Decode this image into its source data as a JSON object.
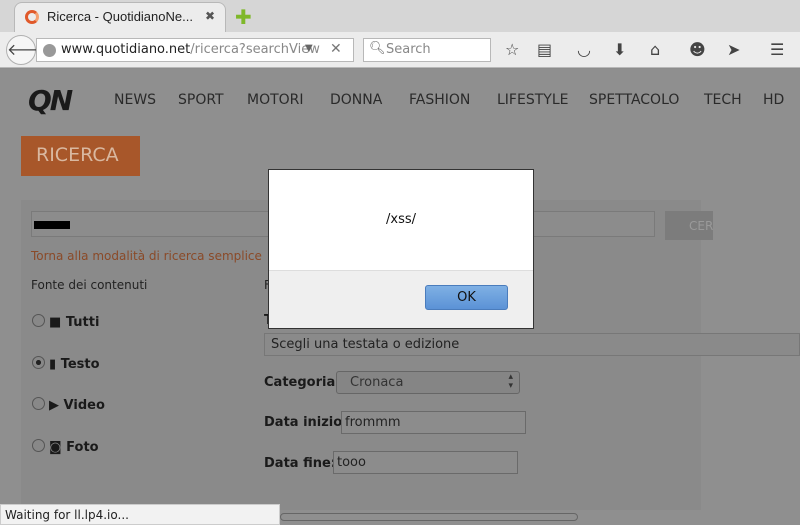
{
  "browser": {
    "tab_title": "Ricerca - QuotidianoNe...",
    "url_host": "www.quotidiano.net",
    "url_path": "/ricerca?searchView",
    "search_placeholder": "Search",
    "status": "Waiting for ll.lp4.io..."
  },
  "site": {
    "logo": "QN",
    "nav": [
      "NEWS",
      "SPORT",
      "MOTORI",
      "DONNA",
      "FASHION",
      "LIFESTYLE",
      "SPETTACOLO",
      "TECH",
      "HD"
    ],
    "heading": "RICERCA",
    "search_button": "CER",
    "back_link": "Torna alla modalità di ricerca semplice",
    "source_label": "Fonte dei contenuti",
    "partial_label": "F",
    "partial_label2": "T",
    "sources": [
      {
        "label": "Tutti",
        "selected": false
      },
      {
        "label": "Testo",
        "selected": true
      },
      {
        "label": "Video",
        "selected": false
      },
      {
        "label": "Foto",
        "selected": false
      }
    ],
    "testata_placeholder": "Scegli una testata o edizione",
    "category_label": "Categoria:",
    "category_value": "Cronaca",
    "start_label": "Data inizio:",
    "start_value": "frommm",
    "end_label": "Data fine:",
    "end_value": "tooo"
  },
  "dialog": {
    "message": "/xss/",
    "ok": "OK"
  }
}
